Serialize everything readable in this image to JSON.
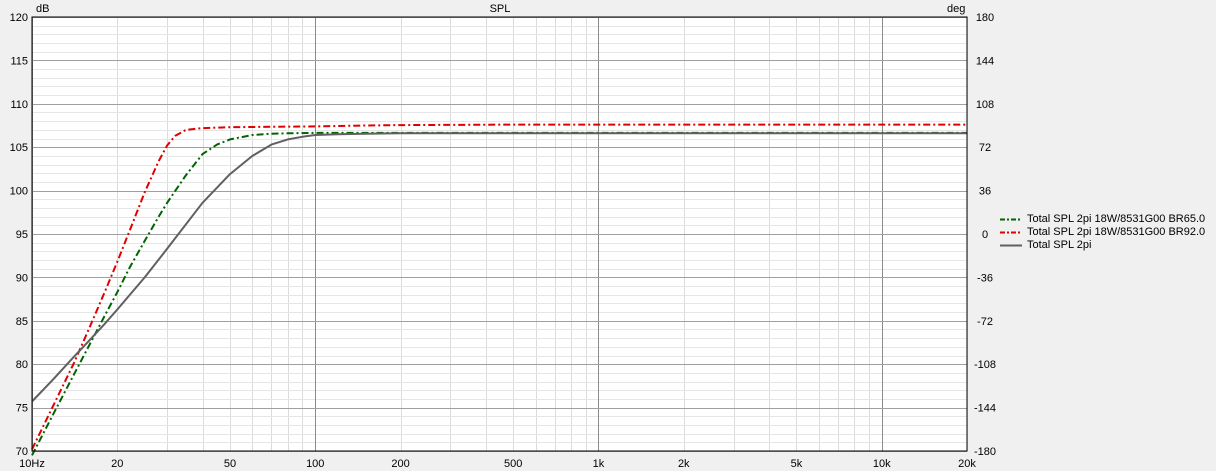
{
  "chart_data": {
    "type": "line",
    "title": "SPL",
    "ylabel": "dB",
    "y2label": "deg",
    "x_scale": "log",
    "xlim": [
      10,
      20000
    ],
    "ylim": [
      70,
      120
    ],
    "y2lim": [
      -180,
      180
    ],
    "grid": true,
    "legend_position": "right",
    "x_ticks": [
      10,
      20,
      50,
      100,
      200,
      500,
      1000,
      2000,
      5000,
      10000,
      20000
    ],
    "x_tick_labels": [
      "10Hz",
      "20",
      "50",
      "100",
      "200",
      "500",
      "1k",
      "2k",
      "5k",
      "10k",
      "20k"
    ],
    "y_ticks": [
      70,
      75,
      80,
      85,
      90,
      95,
      100,
      105,
      110,
      115,
      120
    ],
    "y_tick_labels": [
      "70",
      "75",
      "80",
      "85",
      "90",
      "95",
      "100",
      "105",
      "110",
      "115",
      "120"
    ],
    "y2_ticks": [
      -180,
      -144,
      -108,
      -72,
      -36,
      0,
      36,
      72,
      108,
      144,
      180
    ],
    "y2_tick_labels": [
      "-180",
      "-144",
      "-108",
      "-72",
      "-36",
      "0",
      "36",
      "72",
      "108",
      "144",
      "180"
    ],
    "series": [
      {
        "name": "Total SPL 2pi 18W/8531G00 BR65.0",
        "color": "#006400",
        "dash": "dashdot",
        "x": [
          10,
          12,
          14,
          16,
          18,
          20,
          22,
          25,
          28,
          30,
          35,
          40,
          45,
          50,
          60,
          70,
          80,
          100,
          150,
          200,
          500,
          1000,
          2000,
          5000,
          10000,
          20000
        ],
        "y": [
          69.5,
          74.5,
          78.7,
          82.3,
          85.5,
          88.3,
          91.0,
          94.2,
          97.0,
          98.6,
          101.8,
          104.2,
          105.3,
          105.9,
          106.4,
          106.55,
          106.6,
          106.65,
          106.65,
          106.65,
          106.65,
          106.65,
          106.65,
          106.65,
          106.65,
          106.65
        ]
      },
      {
        "name": "Total SPL 2pi 18W/8531G00 BR92.0",
        "color": "#e00000",
        "dash": "dashdot",
        "x": [
          10,
          12,
          14,
          16,
          18,
          20,
          22,
          25,
          28,
          30,
          32,
          35,
          40,
          50,
          70,
          100,
          150,
          200,
          500,
          1000,
          2000,
          5000,
          10000,
          20000
        ],
        "y": [
          70.2,
          75.5,
          80.0,
          84.3,
          88.2,
          91.8,
          95.2,
          99.8,
          103.4,
          105.2,
          106.3,
          107.0,
          107.2,
          107.3,
          107.35,
          107.4,
          107.5,
          107.55,
          107.6,
          107.6,
          107.6,
          107.6,
          107.6,
          107.6
        ]
      },
      {
        "name": "Total SPL 2pi",
        "color": "#606060",
        "dash": "solid",
        "x": [
          10,
          12,
          14,
          16,
          18,
          20,
          25,
          30,
          40,
          50,
          60,
          70,
          80,
          90,
          100,
          120,
          150,
          200,
          500,
          1000,
          2000,
          5000,
          10000,
          20000
        ],
        "y": [
          75.7,
          78.4,
          80.8,
          82.8,
          84.6,
          86.3,
          90.0,
          93.3,
          98.6,
          101.9,
          104.0,
          105.3,
          105.9,
          106.2,
          106.4,
          106.5,
          106.55,
          106.6,
          106.6,
          106.6,
          106.6,
          106.6,
          106.6,
          106.6
        ]
      }
    ]
  }
}
